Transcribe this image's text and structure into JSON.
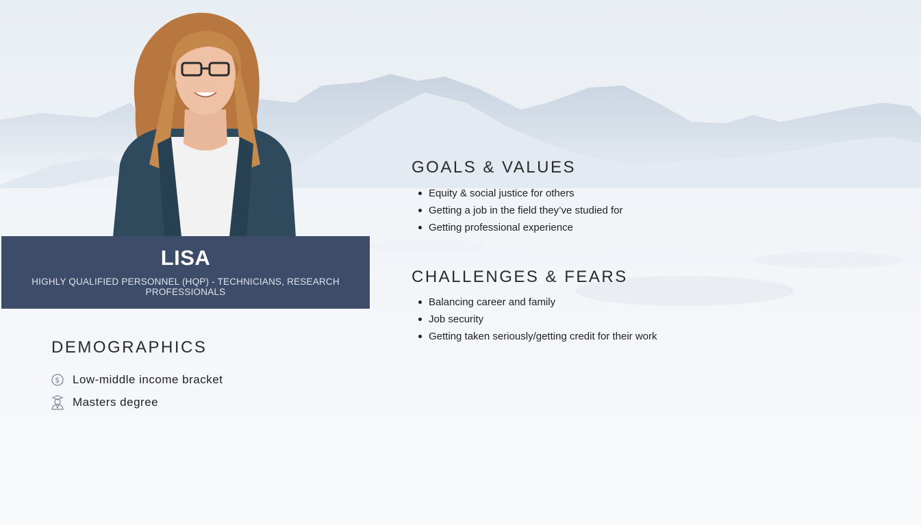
{
  "persona": {
    "name": "LISA",
    "role": "HIGHLY QUALIFIED PERSONNEL (HQP) - TECHNICIANS, RESEARCH PROFESSIONALS"
  },
  "demographics": {
    "title": "DEMOGRAPHICS",
    "items": [
      {
        "icon": "dollar-coin-icon",
        "label": "Low-middle income bracket"
      },
      {
        "icon": "graduate-icon",
        "label": "Masters degree"
      }
    ]
  },
  "goals": {
    "title": "GOALS & VALUES",
    "items": [
      "Equity & social justice for others",
      "Getting a job in the field they’ve studied for",
      "Getting professional experience"
    ]
  },
  "challenges": {
    "title": "CHALLENGES & FEARS",
    "items": [
      "Balancing career and family",
      "Job security",
      "Getting taken seriously/getting credit for their work"
    ]
  },
  "colors": {
    "banner": "#3d4c68",
    "text": "#1f1f1f",
    "icon": "#7a8597"
  }
}
